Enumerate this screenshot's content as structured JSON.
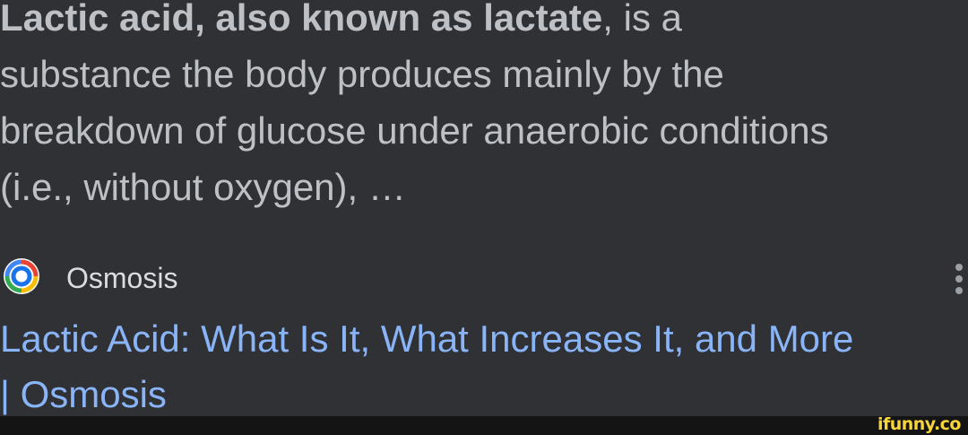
{
  "result": {
    "snippet": {
      "bold_lead": "Lactic acid, also known as lactate",
      "line1_rest": ", is a",
      "line2": "substance the body produces mainly by the",
      "line3": "breakdown of glucose under anaerobic conditions",
      "line4": "(i.e., without oxygen), …"
    },
    "source": {
      "name": "Osmosis",
      "favicon_icon": "osmosis-logo-icon",
      "more_icon": "more-vert-icon"
    },
    "title": {
      "line1": "Lactic Acid: What Is It, What Increases It, and More",
      "line2": "| Osmosis"
    }
  },
  "watermark": "ifunny.co",
  "colors": {
    "background": "#303134",
    "snippet_text": "#bdc1c6",
    "link": "#8ab4f8",
    "source_text": "#dadce0",
    "watermark": "#f7d43a"
  }
}
